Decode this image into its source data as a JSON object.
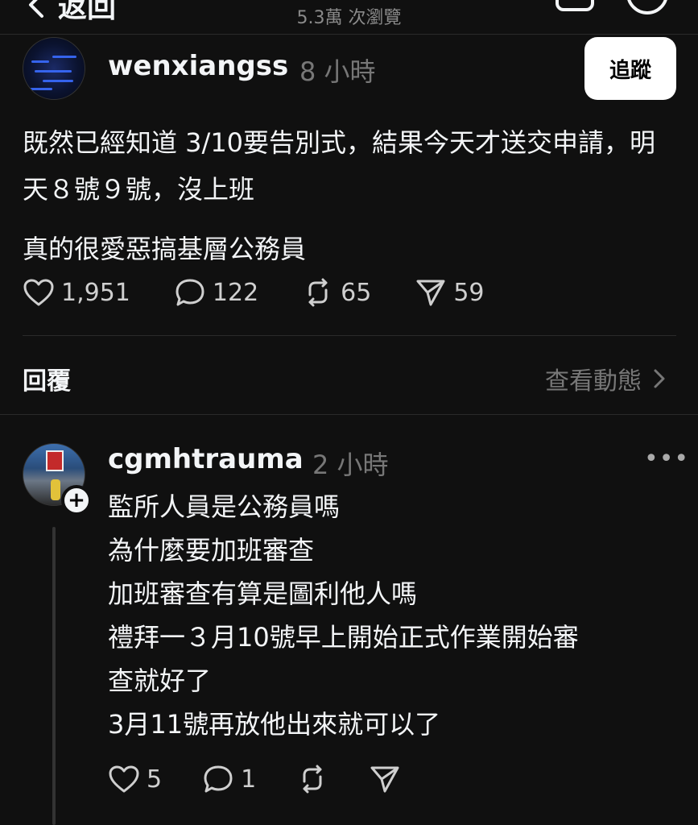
{
  "header": {
    "back_label": "返回",
    "views": "5.3萬 次瀏覽"
  },
  "post": {
    "username": "wenxiangss",
    "time": "8 小時",
    "follow_label": "追蹤",
    "lines": [
      "既然已經知道 3/10要告別式，結果今天才送交申請，明天８號９號，沒上班",
      "真的很愛惡搞基層公務員"
    ],
    "likes": "1,951",
    "comments": "122",
    "reposts": "65",
    "shares": "59"
  },
  "replies_section": {
    "label": "回覆",
    "activity_label": "查看動態"
  },
  "reply": {
    "username": "cgmhtrauma",
    "time": "2 小時",
    "more": "•••",
    "lines": [
      "監所人員是公務員嗎",
      "為什麼要加班審查",
      "加班審查有算是圖利他人嗎",
      "禮拜一３月10號早上開始正式作業開始審",
      "查就好了",
      "3月11號再放他出來就可以了"
    ],
    "likes": "5",
    "comments": "1"
  }
}
